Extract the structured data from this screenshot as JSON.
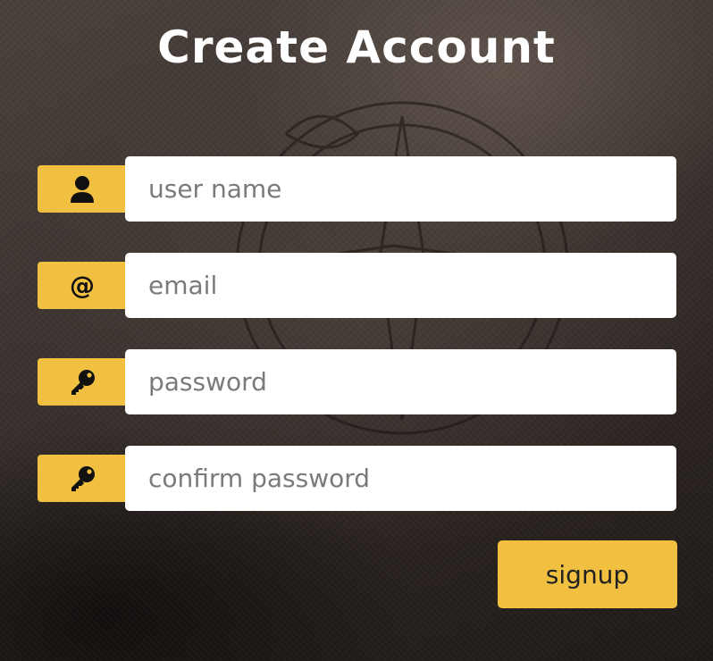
{
  "form": {
    "title": "Create Account",
    "fields": [
      {
        "icon": "user-icon",
        "placeholder": "user name",
        "value": ""
      },
      {
        "icon": "at-icon",
        "glyph": "@",
        "placeholder": "email",
        "value": ""
      },
      {
        "icon": "key-icon",
        "placeholder": "password",
        "value": ""
      },
      {
        "icon": "key-icon",
        "placeholder": "confirm password",
        "value": ""
      }
    ],
    "submit_label": "signup"
  },
  "colors": {
    "accent": "#f1c040",
    "title_text": "#ffffff",
    "input_bg": "#ffffff",
    "placeholder_text": "#7a7a7a"
  }
}
